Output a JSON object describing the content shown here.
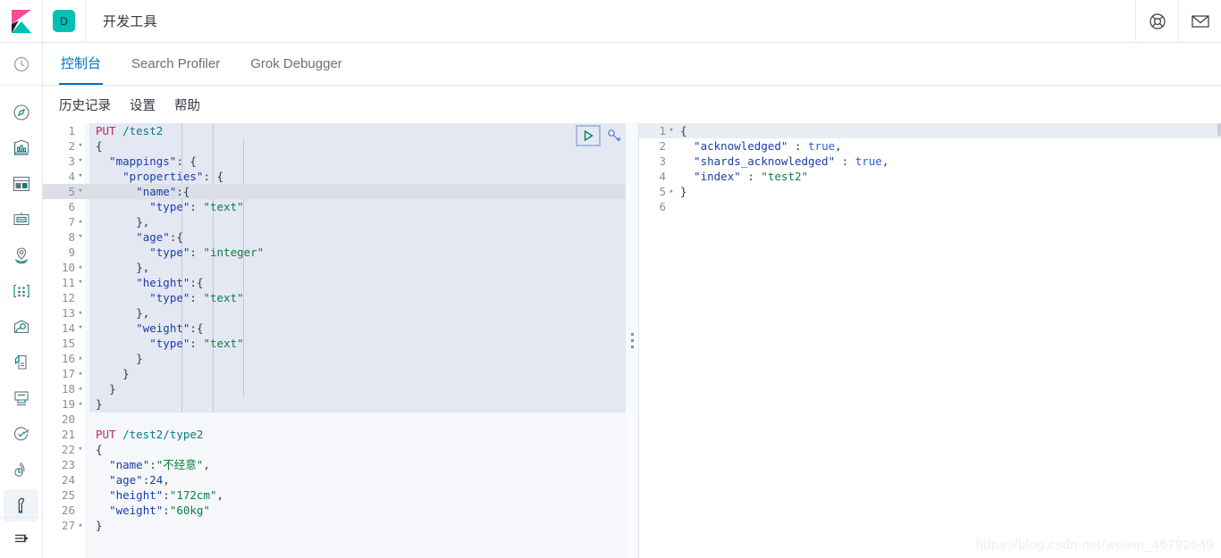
{
  "header": {
    "logo_name": "kibana-logo",
    "app_badge": "D",
    "title": "开发工具",
    "help_icon": "help-lifebuoy-icon",
    "mail_icon": "mail-envelope-icon"
  },
  "rail": {
    "top_icon": "recently-viewed-clock-icon",
    "items": [
      {
        "icon": "discover-compass-icon",
        "label": "Discover"
      },
      {
        "icon": "visualize-chart-icon",
        "label": "Visualize"
      },
      {
        "icon": "dashboard-grid-icon",
        "label": "Dashboard"
      },
      {
        "icon": "canvas-frame-icon",
        "label": "Canvas"
      },
      {
        "icon": "maps-pin-icon",
        "label": "Maps"
      },
      {
        "icon": "machine-learning-icon",
        "label": "Machine Learning"
      },
      {
        "icon": "infrastructure-icon",
        "label": "Infrastructure"
      },
      {
        "icon": "logs-page-icon",
        "label": "Logs"
      },
      {
        "icon": "apm-monitor-icon",
        "label": "APM"
      },
      {
        "icon": "uptime-check-icon",
        "label": "Uptime"
      },
      {
        "icon": "stack-monitoring-icon",
        "label": "Stack Monitoring"
      },
      {
        "icon": "dev-tools-wrench-icon",
        "label": "开发工具",
        "active": true
      }
    ],
    "collapse_icon": "collapse-nav-arrow-icon"
  },
  "tabs": [
    {
      "label": "控制台",
      "active": true
    },
    {
      "label": "Search Profiler",
      "active": false
    },
    {
      "label": "Grok Debugger",
      "active": false
    }
  ],
  "submenu": [
    {
      "label": "历史记录"
    },
    {
      "label": "设置"
    },
    {
      "label": "帮助"
    }
  ],
  "request_editor": {
    "play_icon": "play-run-request-icon",
    "wrench_icon": "wrench-options-icon",
    "active_line": 5,
    "lines": [
      {
        "n": 1,
        "fold": "",
        "text": "PUT /test2",
        "type": "request"
      },
      {
        "n": 2,
        "fold": "▾",
        "text": "{",
        "type": "punct"
      },
      {
        "n": 3,
        "fold": "▾",
        "text": "  \"mappings\": {",
        "type": "kv"
      },
      {
        "n": 4,
        "fold": "▾",
        "text": "    \"properties\": {",
        "type": "kv"
      },
      {
        "n": 5,
        "fold": "▾",
        "text": "      \"name\":{",
        "type": "kv"
      },
      {
        "n": 6,
        "fold": "",
        "text": "        \"type\": \"text\"",
        "type": "kv"
      },
      {
        "n": 7,
        "fold": "▴",
        "text": "      },",
        "type": "punct"
      },
      {
        "n": 8,
        "fold": "▾",
        "text": "      \"age\":{",
        "type": "kv"
      },
      {
        "n": 9,
        "fold": "",
        "text": "        \"type\": \"integer\"",
        "type": "kv"
      },
      {
        "n": 10,
        "fold": "▴",
        "text": "      },",
        "type": "punct"
      },
      {
        "n": 11,
        "fold": "▾",
        "text": "      \"height\":{",
        "type": "kv"
      },
      {
        "n": 12,
        "fold": "",
        "text": "        \"type\": \"text\"",
        "type": "kv"
      },
      {
        "n": 13,
        "fold": "▴",
        "text": "      },",
        "type": "punct"
      },
      {
        "n": 14,
        "fold": "▾",
        "text": "      \"weight\":{",
        "type": "kv"
      },
      {
        "n": 15,
        "fold": "",
        "text": "        \"type\": \"text\"",
        "type": "kv"
      },
      {
        "n": 16,
        "fold": "▴",
        "text": "      }",
        "type": "punct"
      },
      {
        "n": 17,
        "fold": "▴",
        "text": "    }",
        "type": "punct"
      },
      {
        "n": 18,
        "fold": "▴",
        "text": "  }",
        "type": "punct"
      },
      {
        "n": 19,
        "fold": "▴",
        "text": "}",
        "type": "punct"
      },
      {
        "n": 20,
        "fold": "",
        "text": "",
        "type": "blank"
      },
      {
        "n": 21,
        "fold": "",
        "text": "PUT /test2/type2",
        "type": "request"
      },
      {
        "n": 22,
        "fold": "▾",
        "text": "{",
        "type": "punct"
      },
      {
        "n": 23,
        "fold": "",
        "text": "  \"name\":\"不经意\",",
        "type": "kv"
      },
      {
        "n": 24,
        "fold": "",
        "text": "  \"age\":24,",
        "type": "kvnum"
      },
      {
        "n": 25,
        "fold": "",
        "text": "  \"height\":\"172cm\",",
        "type": "kv"
      },
      {
        "n": 26,
        "fold": "",
        "text": "  \"weight\":\"60kg\"",
        "type": "kv"
      },
      {
        "n": 27,
        "fold": "▴",
        "text": "}",
        "type": "punct"
      }
    ]
  },
  "response_editor": {
    "active_line": 1,
    "lines": [
      {
        "n": 1,
        "fold": "▾",
        "text": "{",
        "type": "punct"
      },
      {
        "n": 2,
        "fold": "",
        "text": "  \"acknowledged\" : true,",
        "type": "kvbool"
      },
      {
        "n": 3,
        "fold": "",
        "text": "  \"shards_acknowledged\" : true,",
        "type": "kvbool"
      },
      {
        "n": 4,
        "fold": "",
        "text": "  \"index\" : \"test2\"",
        "type": "kv"
      },
      {
        "n": 5,
        "fold": "▴",
        "text": "}",
        "type": "punct"
      },
      {
        "n": 6,
        "fold": "",
        "text": "",
        "type": "blank"
      }
    ]
  },
  "watermark": "https://blog.csdn.net/weixin_46792649",
  "colors": {
    "accent_blue": "#0071c2",
    "teal": "#00bfb3",
    "pink": "#f04e98",
    "method": "#c0285c",
    "url": "#0a7b83",
    "key": "#1a3ea8",
    "string": "#0a8043",
    "bool": "#2b5fd9",
    "editor_bg": "#f5f7fa",
    "selection": "#e4e8f2"
  }
}
